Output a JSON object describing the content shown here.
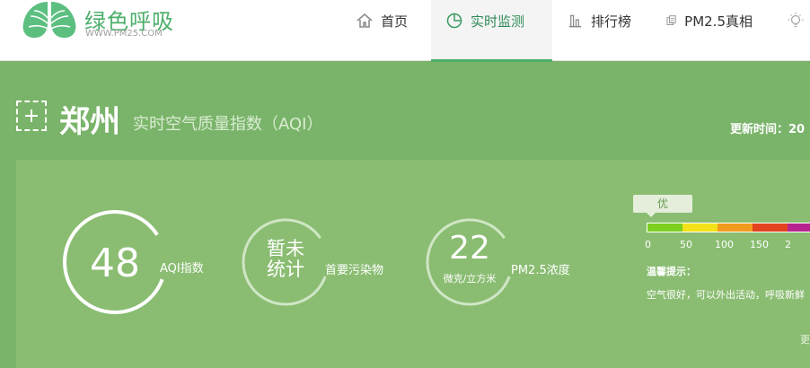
{
  "logo": {
    "title": "绿色呼吸",
    "subtitle": "WWW.PM25.COM"
  },
  "nav": {
    "items": [
      {
        "label": "首页",
        "icon": "home-icon"
      },
      {
        "label": "实时监测",
        "icon": "pie-chart-icon",
        "active": true
      },
      {
        "label": "排行榜",
        "icon": "bar-chart-icon"
      },
      {
        "label": "PM2.5真相",
        "icon": "document-icon"
      },
      {
        "label": "",
        "icon": "lightbulb-icon"
      }
    ]
  },
  "city": {
    "name": "郑州",
    "subtitle": "实时空气质量指数（AQI）",
    "update_time": "更新时间：20"
  },
  "metrics": {
    "aqi": {
      "value": "48",
      "label": "AQI指数"
    },
    "pollutant": {
      "line1": "暂未",
      "line2": "统计",
      "label": "首要污染物"
    },
    "pm25": {
      "value": "22",
      "unit": "微克/立方米",
      "label": "PM2.5浓度"
    }
  },
  "scale": {
    "current_level": "优",
    "segment_colors": [
      "#7ccf1e",
      "#f3e11a",
      "#f39a1c",
      "#e2431e",
      "#b7248f"
    ],
    "ticks": [
      "0",
      "50",
      "100",
      "150",
      "2"
    ]
  },
  "tips": {
    "title": "温馨提示：",
    "text": "空气很好，可以外出活动，呼吸新鲜",
    "more": "更"
  },
  "colors": {
    "accent": "#4caf6a",
    "background": "#7ab46a",
    "panel": "#8abd72"
  }
}
